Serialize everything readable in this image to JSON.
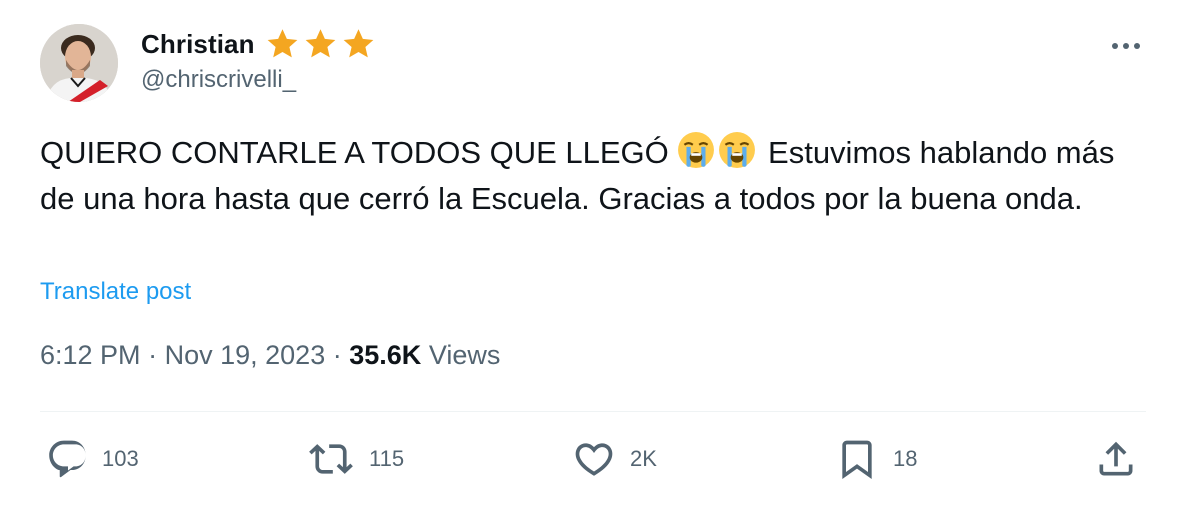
{
  "author": {
    "display_name": "Christian",
    "handle": "@chriscrivelli_",
    "badges": [
      "star-icon",
      "star-icon",
      "star-icon"
    ],
    "badge_color": "#f4a621"
  },
  "post": {
    "text_part1": "QUIERO CONTARLE A TODOS QUE LLEGÓ",
    "emojis": [
      "loudly-crying-face-icon",
      "loudly-crying-face-icon"
    ],
    "text_part2": "Estuvimos hablando más de una hora hasta que cerró la Escuela. Gracias a todos por la buena onda.",
    "translate_label": "Translate post"
  },
  "meta": {
    "time": "6:12 PM",
    "separator": "·",
    "date": "Nov 19, 2023",
    "views_count": "35.6K",
    "views_label": "Views"
  },
  "actions": {
    "replies": "103",
    "reposts": "115",
    "likes": "2K",
    "bookmarks": "18"
  },
  "colors": {
    "text": "#0f1419",
    "secondary": "#536471",
    "link": "#1d9bf0",
    "divider": "#eff3f4"
  }
}
